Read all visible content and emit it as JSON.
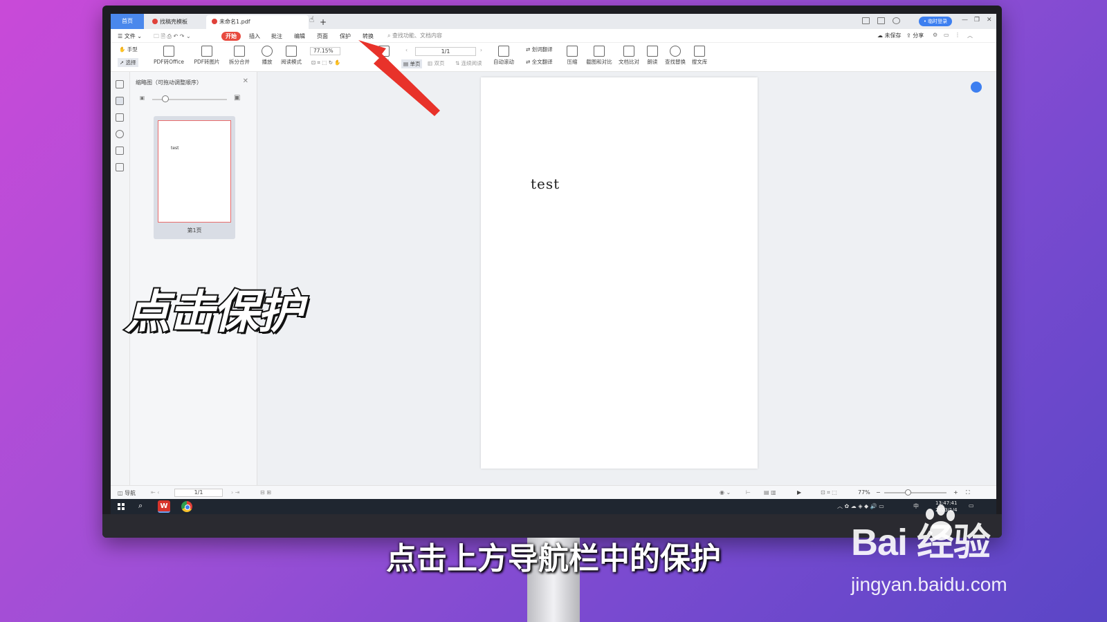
{
  "tabs": {
    "home": "首页",
    "template": "找稿壳模板",
    "file": "未命名1.pdf",
    "plus": "+"
  },
  "titlebar": {
    "login": "• 临时登录"
  },
  "menu": {
    "file": "文件",
    "start": "开始",
    "insert": "插入",
    "annotate": "批注",
    "edit": "编辑",
    "page": "页面",
    "protect": "保护",
    "convert": "转换",
    "search_placeholder": "查找功能、文档内容",
    "unsaved": "未保存",
    "share": "分享"
  },
  "ribbon": {
    "hand": "手型",
    "select": "选择",
    "pdf_to_office": "PDF转Office",
    "pdf_to_image": "PDF转图片",
    "split_merge": "拆分合并",
    "play": "播放",
    "read_mode": "阅读模式",
    "zoom": "77.15%",
    "doc": "文档",
    "page_value": "1/1",
    "single": "单页",
    "double": "双页",
    "continuous": "连续阅读",
    "auto_scroll": "自动滚动",
    "word_translate": "划词翻译",
    "full_translate": "全文翻译",
    "compress": "压缩",
    "screenshot_compare": "截图和对比",
    "doc_compare": "文档比对",
    "read_aloud": "朗读",
    "find_replace": "查找替换",
    "search_lib": "搜文库"
  },
  "thumbnail": {
    "title": "缩略图（可拖动调整顺序）",
    "page_text": "test",
    "page_label": "第1页"
  },
  "document": {
    "text": "test"
  },
  "statusbar": {
    "nav": "导航",
    "page": "1/1",
    "zoom": "77%"
  },
  "taskbar": {
    "time": "13:47:41",
    "date": "2023/1/4",
    "ime": "中"
  },
  "overlay": {
    "caption": "点击保护",
    "subtitle": "点击上方导航栏中的保护",
    "watermark_brand": "Bai  经验",
    "watermark_url": "jingyan.baidu.com"
  },
  "colors": {
    "accent": "#e84a3f",
    "brand_blue": "#3d7ff0",
    "arrow": "#e8322a"
  }
}
